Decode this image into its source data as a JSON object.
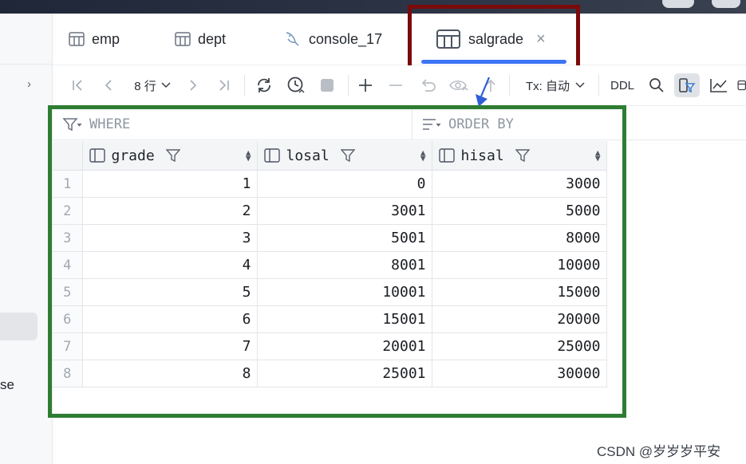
{
  "tabs": [
    {
      "label": "emp",
      "icon": "table-icon"
    },
    {
      "label": "dept",
      "icon": "table-icon"
    },
    {
      "label": "console_17",
      "icon": "console-icon"
    },
    {
      "label": "salgrade",
      "icon": "table-icon",
      "active": true,
      "close": "×"
    }
  ],
  "toolbar": {
    "rows_label": "8 行",
    "tx_label": "Tx: 自动",
    "ddl_label": "DDL"
  },
  "filter": {
    "where_placeholder": "WHERE",
    "orderby_placeholder": "ORDER BY"
  },
  "sidebar": {
    "partial_text": "se"
  },
  "table": {
    "columns": [
      "grade",
      "losal",
      "hisal"
    ],
    "rows": [
      {
        "n": "1",
        "grade": "1",
        "losal": "0",
        "hisal": "3000"
      },
      {
        "n": "2",
        "grade": "2",
        "losal": "3001",
        "hisal": "5000"
      },
      {
        "n": "3",
        "grade": "3",
        "losal": "5001",
        "hisal": "8000"
      },
      {
        "n": "4",
        "grade": "4",
        "losal": "8001",
        "hisal": "10000"
      },
      {
        "n": "5",
        "grade": "5",
        "losal": "10001",
        "hisal": "15000"
      },
      {
        "n": "6",
        "grade": "6",
        "losal": "15001",
        "hisal": "20000"
      },
      {
        "n": "7",
        "grade": "7",
        "losal": "20001",
        "hisal": "25000"
      },
      {
        "n": "8",
        "grade": "8",
        "losal": "25001",
        "hisal": "30000"
      }
    ]
  },
  "watermark": "CSDN @岁岁岁平安",
  "colors": {
    "annotation_red": "#7a0b0b",
    "annotation_green": "#2e7d32",
    "annotation_arrow": "#2f5fd6",
    "active_tab_underline": "#3d74f5"
  }
}
